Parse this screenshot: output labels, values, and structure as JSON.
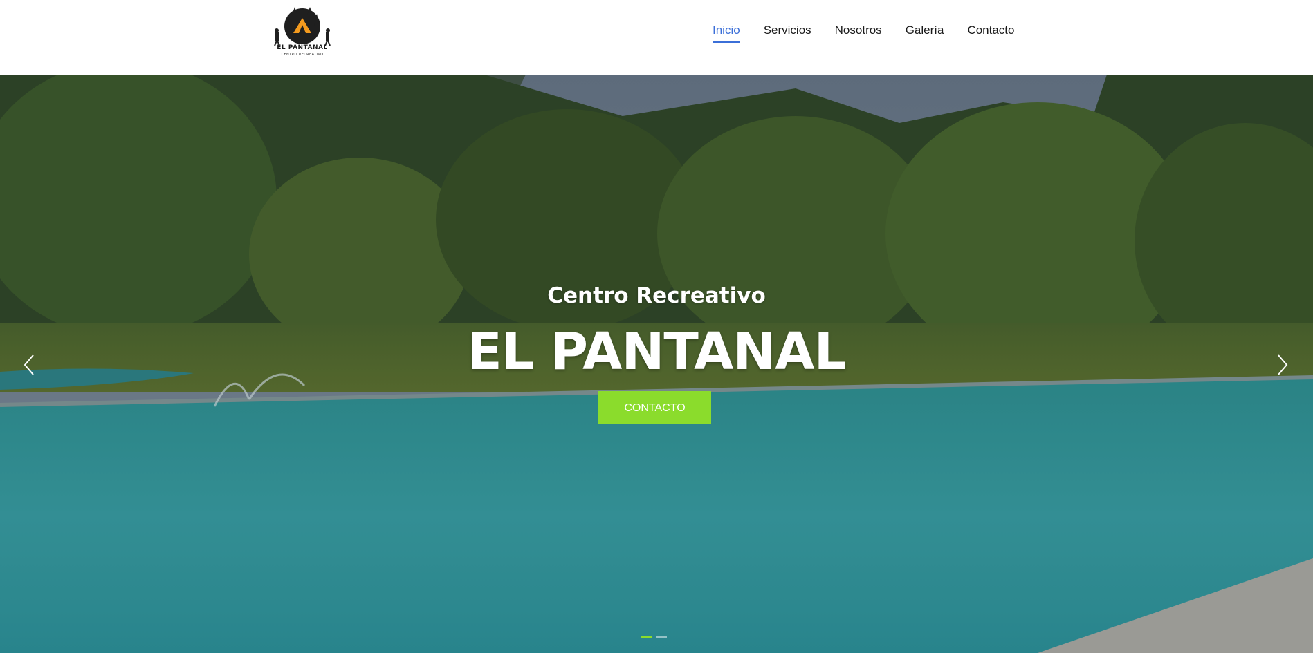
{
  "brand": {
    "name": "EL PANTANAL",
    "tagline": "CENTRO RECREATIVO"
  },
  "nav": {
    "items": [
      {
        "label": "Inicio",
        "active": true
      },
      {
        "label": "Servicios",
        "active": false
      },
      {
        "label": "Nosotros",
        "active": false
      },
      {
        "label": "Galería",
        "active": false
      },
      {
        "label": "Contacto",
        "active": false
      }
    ]
  },
  "hero": {
    "subtitle": "Centro Recreativo",
    "title": "EL PANTANAL",
    "cta_label": "CONTACTO",
    "slides_total": 2,
    "slide_active": 1
  },
  "colors": {
    "accent": "#8bdc2c",
    "nav_active": "#3b6fd8",
    "logo_orange": "#f39a1e"
  }
}
